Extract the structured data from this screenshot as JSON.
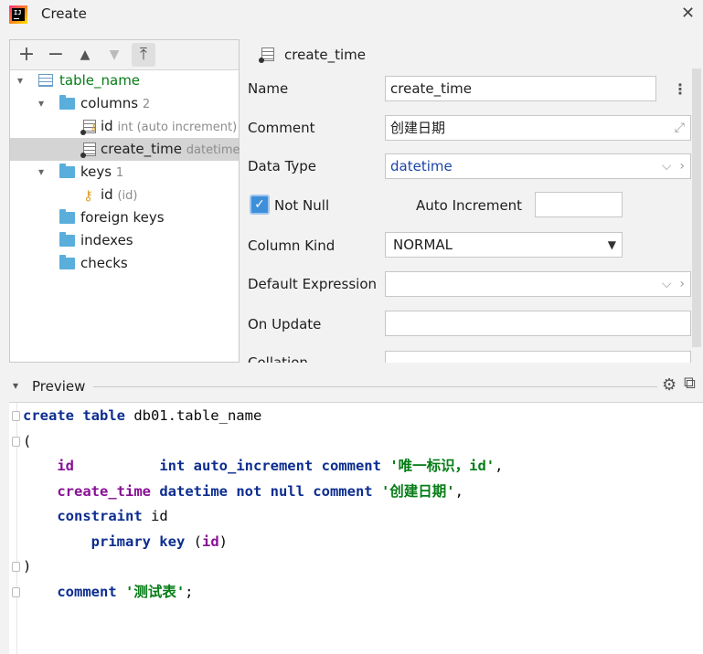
{
  "window": {
    "title": "Create",
    "close_icon": "close-icon",
    "app_icon": "intellij-app-icon"
  },
  "tree_toolbar": {
    "add": "+",
    "remove": "−",
    "up": "▲",
    "down": "▼",
    "pin": "⤒"
  },
  "tree": {
    "table": {
      "name": "table_name"
    },
    "columns": {
      "label": "columns",
      "count": "2"
    },
    "col_id": {
      "name": "id",
      "hint": "int (auto increment)"
    },
    "col_create_time": {
      "name": "create_time",
      "hint": "datetime"
    },
    "keys": {
      "label": "keys",
      "count": "1"
    },
    "key_id": {
      "name": "id",
      "hint": "(id)"
    },
    "foreign_keys": "foreign keys",
    "indexes": "indexes",
    "checks": "checks"
  },
  "properties": {
    "header": "create_time",
    "name_label": "Name",
    "name_value": "create_time",
    "comment_label": "Comment",
    "comment_value": "创建日期",
    "data_type_label": "Data Type",
    "data_type_value": "datetime",
    "not_null_label": "Not Null",
    "not_null_checked": true,
    "auto_increment_label": "Auto Increment",
    "auto_increment_value": "",
    "column_kind_label": "Column Kind",
    "column_kind_value": "NORMAL",
    "default_expression_label": "Default Expression",
    "default_expression_value": "",
    "on_update_label": "On Update",
    "on_update_value": "",
    "collation_label": "Collation",
    "collation_value": ""
  },
  "preview": {
    "label": "Preview",
    "code": {
      "l1": {
        "kw1": "create table",
        "rest": " db01.table_name"
      },
      "l2": "(",
      "l3": {
        "ident": "id",
        "kw": "int auto_increment comment",
        "str": "'唯一标识，id'",
        "end": ","
      },
      "l4": {
        "ident": "create_time",
        "kw": "datetime not null comment",
        "str": "'创建日期'",
        "end": ","
      },
      "l5": {
        "kw": "constraint",
        "rest": " id"
      },
      "l6": {
        "kw": "primary key",
        "rest": " (",
        "ident": "id",
        "end": ")"
      },
      "l7": ")",
      "l8": {
        "kw": "comment",
        "str": "'测试表'",
        "end": ";"
      }
    }
  },
  "colors": {
    "accent": "#3d8fd9",
    "keyword": "#0c2d8f",
    "identifier": "#871094",
    "string": "#067d17",
    "folder": "#5aaedb"
  }
}
